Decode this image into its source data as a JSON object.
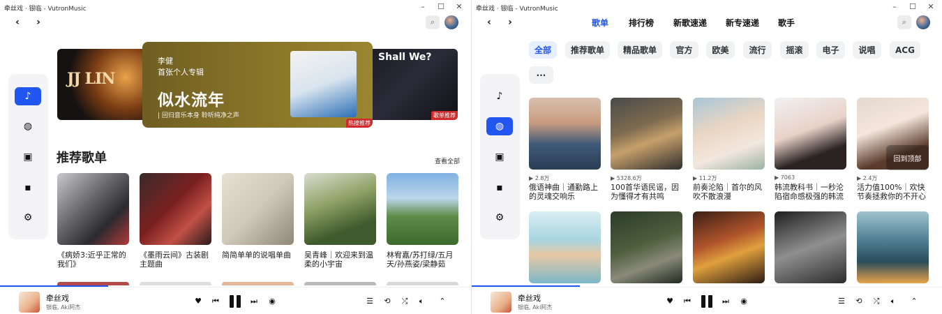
{
  "left": {
    "title": "牵丝戏 · 银临 - VutronMusic",
    "banner": {
      "sub1": "李健",
      "sub2": "首张个人专辑",
      "title": "似水流年",
      "tag": "| 回归音乐本身 聆听纯净之声",
      "badge": "热搜推荐",
      "right_badge": "歌单推荐"
    },
    "section_title": "推荐歌单",
    "see_all": "查看全部",
    "playlists": [
      {
        "name": "《病娇3:近乎正常的我们》"
      },
      {
        "name": "《墨雨云间》古装剧主题曲"
      },
      {
        "name": "简简单单的说唱单曲"
      },
      {
        "name": "吴青峰｜欢迎来到温柔的小宇宙"
      },
      {
        "name": "林宥嘉/苏打绿/五月天/孙燕姿/梁静茹"
      }
    ]
  },
  "right": {
    "title": "牵丝戏 · 银临 - VutronMusic",
    "tabs": [
      "歌单",
      "排行榜",
      "新歌速递",
      "新专速递",
      "歌手"
    ],
    "chips": [
      "全部",
      "推荐歌单",
      "精品歌单",
      "官方",
      "欧美",
      "流行",
      "摇滚",
      "电子",
      "说唱",
      "ACG",
      "···"
    ],
    "back_to_top": "回到顶部",
    "playlists": [
      {
        "plays": "▶ 2.8万",
        "name": "俄语神曲｜通勤路上的灵魂交响乐"
      },
      {
        "plays": "▶ 5328.6万",
        "name": "100首华语民谣，因为懂得才有共鸣"
      },
      {
        "plays": "▶ 11.2万",
        "name": "前奏沦陷｜首尔的风吹不散浪漫"
      },
      {
        "plays": "▶ 7063",
        "name": "韩流教科书｜一秒沦陷宿命感极强的韩流"
      },
      {
        "plays": "▶ 2.4万",
        "name": "活力值100%｜欢快节奏拯救你的不开心"
      }
    ]
  },
  "player": {
    "song": "牵丝戏",
    "artist": "银临, Aki阿杰",
    "progress": 0.23
  },
  "colors": {
    "accent": "#2156f0",
    "badge": "#d22a2a"
  }
}
